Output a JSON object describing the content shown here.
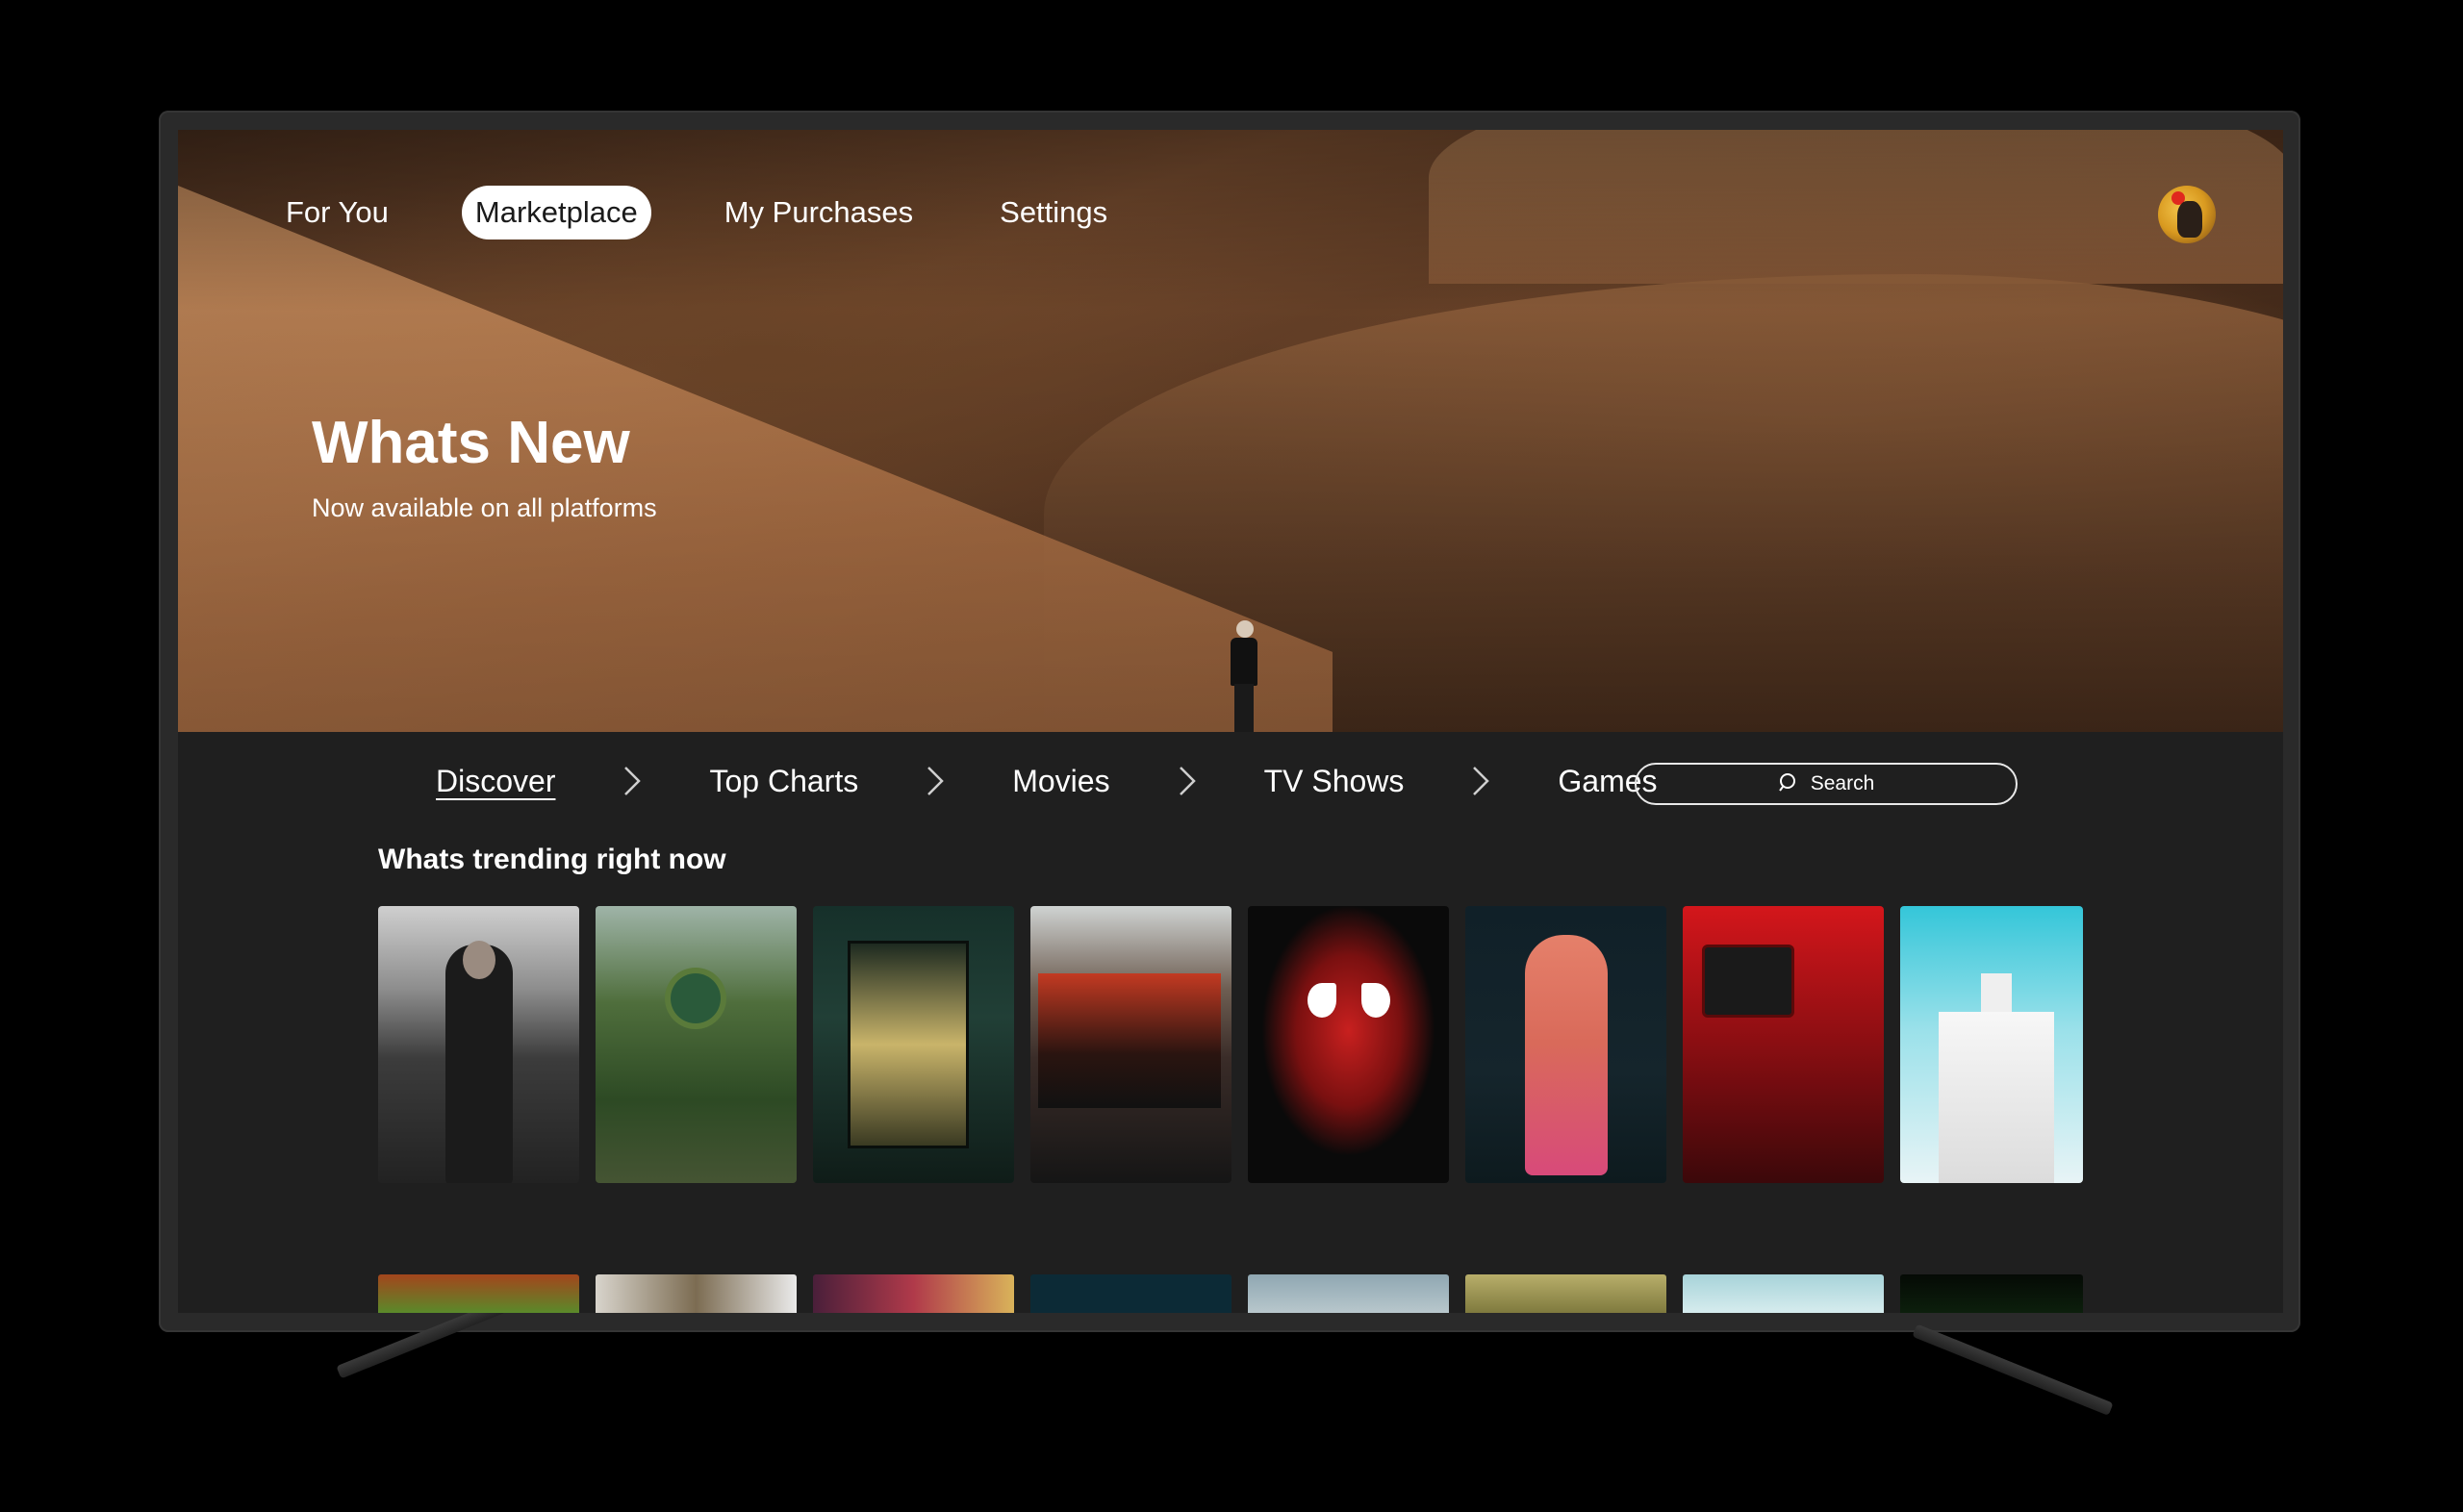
{
  "top_nav": {
    "items": [
      {
        "label": "For You",
        "active": false
      },
      {
        "label": "Marketplace",
        "active": true
      },
      {
        "label": "My Purchases",
        "active": false
      },
      {
        "label": "Settings",
        "active": false
      }
    ]
  },
  "hero": {
    "title": "Whats New",
    "subtitle": "Now available on all platforms"
  },
  "categories": {
    "items": [
      {
        "label": "Discover",
        "active": true
      },
      {
        "label": "Top Charts",
        "active": false
      },
      {
        "label": "Movies",
        "active": false
      },
      {
        "label": "TV Shows",
        "active": false
      },
      {
        "label": "Games",
        "active": false
      }
    ],
    "separator_icon": "chevron-right-icon"
  },
  "search": {
    "label": "Search",
    "icon": "search-icon"
  },
  "trending": {
    "title": "Whats trending right now"
  },
  "colors": {
    "screen_bg": "#1f1f1f",
    "active_pill_bg": "#ffffff",
    "active_pill_text": "#1a1a1a",
    "text": "#ffffff"
  }
}
